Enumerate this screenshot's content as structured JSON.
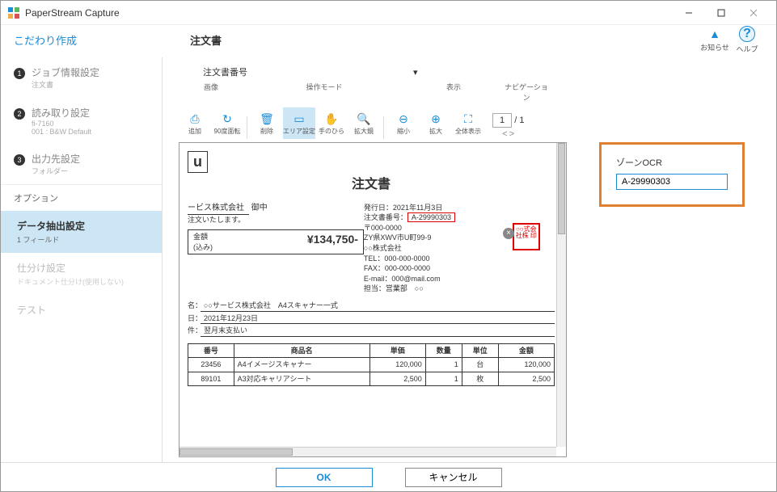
{
  "titlebar": {
    "app_name": "PaperStream Capture"
  },
  "header": {
    "mode_label": "こだわり作成",
    "job_title": "注文書",
    "notify_label": "お知らせ",
    "help_label": "ヘルプ"
  },
  "sidebar": {
    "steps": [
      {
        "label": "ジョブ情報設定",
        "sublabel": "注文書"
      },
      {
        "label": "読み取り設定",
        "sublabel": "fi-7160\n001 : B&W Default"
      },
      {
        "label": "出力先設定",
        "sublabel": "フォルダー"
      }
    ],
    "option_header": "オプション",
    "options": [
      {
        "label": "データ抽出設定",
        "sublabel": "1 フィールド",
        "active": true
      },
      {
        "label": "仕分け設定",
        "sublabel": "ドキュメント仕分け(使用しない)",
        "disabled": true
      },
      {
        "label": "テスト",
        "sublabel": "",
        "disabled": true
      }
    ]
  },
  "fieldrow": {
    "label": "注文書番号",
    "value": "",
    "dropdown_caret": "▾"
  },
  "toolbar": {
    "groups": {
      "image": "画像",
      "mode": "操作モード",
      "view": "表示",
      "nav": "ナビゲーション"
    },
    "buttons": {
      "add": "追加",
      "rotate": "90度面転",
      "delete": "削除",
      "area": "エリア設定",
      "hand": "手のひら",
      "zoom": "拡大鏡",
      "zoomout": "縮小",
      "zoomin": "拡大",
      "fit": "全体表示"
    },
    "nav_current": "1",
    "nav_sep": "/",
    "nav_total": "1"
  },
  "preview": {
    "title": "注文書",
    "logo": "u",
    "vendor_line": "ービス株式会社",
    "vendor_suffix": "御中",
    "order_note": "注文いたします。",
    "total_label_top": "金額",
    "total_label_bottom": "(込み)",
    "total_value": "¥134,750-",
    "issue_label": "発行日：",
    "issue_date": "2021年11月3日",
    "ordernum_label": "注文書番号：",
    "ordernum_value": "A-29990303",
    "addr1": "〒000-0000",
    "addr2": "ZY県XWV市U町99-9",
    "company2": "○○株式会社",
    "tel": "TEL：000-000-0000",
    "fax": "FAX：000-000-0000",
    "email": "E-mail：000@mail.com",
    "contact": "担当：営業部　○○",
    "stamp_text": "○○式会社株 印",
    "details": {
      "item_label": "名：",
      "item_value": "○○サービス株式会社　A4スキャナー一式",
      "date_label": "日：",
      "date_value": "2021年12月23日",
      "cond_label": "件：",
      "cond_value": "翌月末支払い"
    },
    "table": {
      "headers": [
        "番号",
        "商品名",
        "単価",
        "数量",
        "単位",
        "金額"
      ],
      "rows": [
        [
          "23456",
          "A4イメージスキャナー",
          "120,000",
          "1",
          "台",
          "120,000"
        ],
        [
          "89101",
          "A3対応キャリアシート",
          "2,500",
          "1",
          "枚",
          "2,500"
        ]
      ]
    }
  },
  "rightpanel": {
    "label": "ゾーンOCR",
    "value": "A-29990303"
  },
  "footer": {
    "ok": "OK",
    "cancel": "キャンセル"
  }
}
